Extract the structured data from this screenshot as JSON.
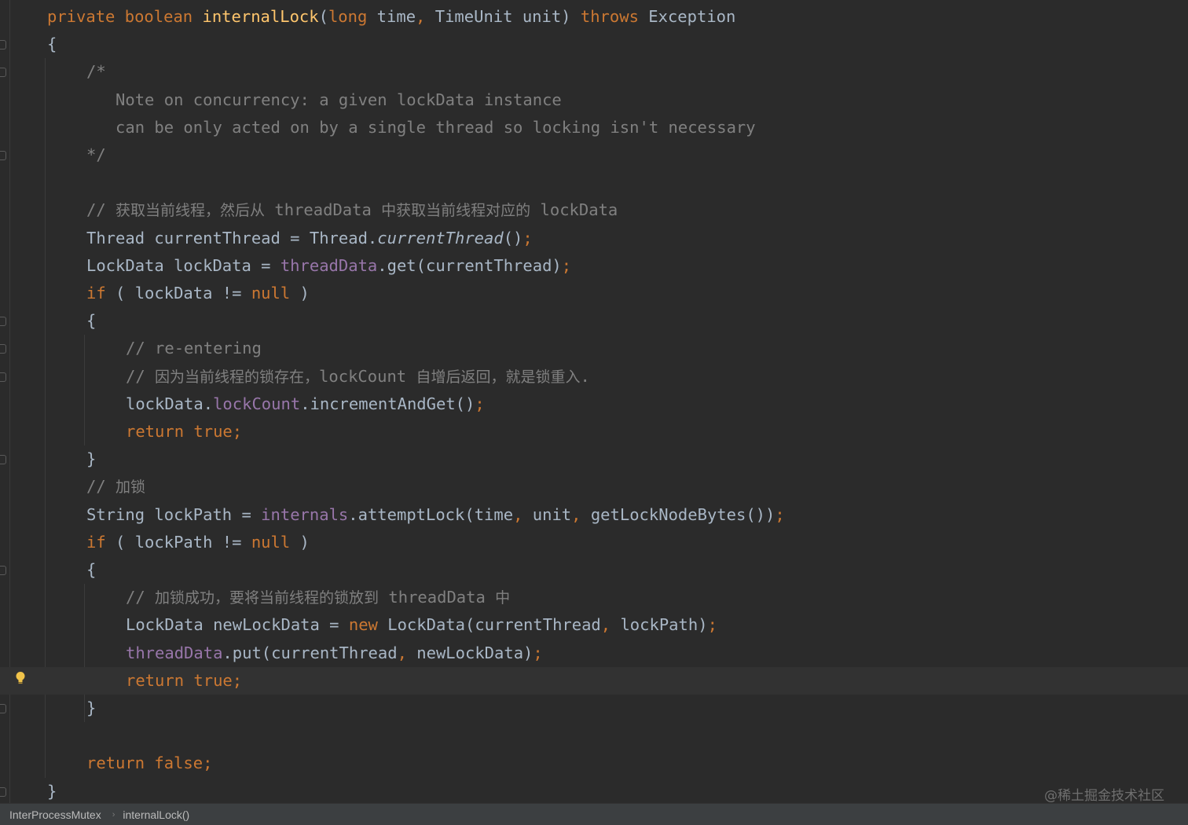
{
  "colors": {
    "background": "#2b2b2b",
    "keyword": "#cc7832",
    "method_declaration": "#ffc66d",
    "identifier": "#a9b7c6",
    "field": "#9876aa",
    "comment": "#808080",
    "current_line": "#323232",
    "breadcrumb_bar": "#3c3f41"
  },
  "editor": {
    "lines": [
      {
        "indent": 0,
        "tokens": [
          {
            "t": "private ",
            "c": "kw"
          },
          {
            "t": "boolean ",
            "c": "kw"
          },
          {
            "t": "internalLock",
            "c": "fn"
          },
          {
            "t": "(",
            "c": "plain"
          },
          {
            "t": "long ",
            "c": "kw"
          },
          {
            "t": "time",
            "c": "plain"
          },
          {
            "t": ", ",
            "c": "punct"
          },
          {
            "t": "TimeUnit unit) ",
            "c": "plain"
          },
          {
            "t": "throws ",
            "c": "kw"
          },
          {
            "t": "Exception",
            "c": "plain"
          }
        ]
      },
      {
        "indent": 0,
        "tokens": [
          {
            "t": "{",
            "c": "plain"
          }
        ]
      },
      {
        "indent": 1,
        "tokens": [
          {
            "t": "/*",
            "c": "comment"
          }
        ]
      },
      {
        "indent": 1,
        "tokens": [
          {
            "t": "   Note on concurrency: a given lockData instance",
            "c": "comment"
          }
        ]
      },
      {
        "indent": 1,
        "tokens": [
          {
            "t": "   can be only acted on by a single thread so locking isn't necessary",
            "c": "comment"
          }
        ]
      },
      {
        "indent": 1,
        "tokens": [
          {
            "t": "*/",
            "c": "comment"
          }
        ]
      },
      {
        "indent": 1,
        "tokens": []
      },
      {
        "indent": 1,
        "tokens": [
          {
            "t": "// ",
            "c": "comment"
          },
          {
            "t": "获取当前线程，然后从",
            "c": "comment-cjk"
          },
          {
            "t": " threadData ",
            "c": "comment"
          },
          {
            "t": "中获取当前线程对应的",
            "c": "comment-cjk"
          },
          {
            "t": " lockData",
            "c": "comment"
          }
        ]
      },
      {
        "indent": 1,
        "tokens": [
          {
            "t": "Thread currentThread = Thread.",
            "c": "plain"
          },
          {
            "t": "currentThread",
            "c": "static"
          },
          {
            "t": "()",
            "c": "plain"
          },
          {
            "t": ";",
            "c": "punct"
          }
        ]
      },
      {
        "indent": 1,
        "tokens": [
          {
            "t": "LockData lockData = ",
            "c": "plain"
          },
          {
            "t": "threadData",
            "c": "field"
          },
          {
            "t": ".get(currentThread)",
            "c": "plain"
          },
          {
            "t": ";",
            "c": "punct"
          }
        ]
      },
      {
        "indent": 1,
        "tokens": [
          {
            "t": "if ",
            "c": "kw"
          },
          {
            "t": "( lockData != ",
            "c": "plain"
          },
          {
            "t": "null ",
            "c": "kw"
          },
          {
            "t": ")",
            "c": "plain"
          }
        ]
      },
      {
        "indent": 1,
        "tokens": [
          {
            "t": "{",
            "c": "plain"
          }
        ]
      },
      {
        "indent": 2,
        "tokens": [
          {
            "t": "// re-entering",
            "c": "comment"
          }
        ]
      },
      {
        "indent": 2,
        "tokens": [
          {
            "t": "// ",
            "c": "comment"
          },
          {
            "t": "因为当前线程的锁存在，",
            "c": "comment-cjk"
          },
          {
            "t": "lockCount ",
            "c": "comment"
          },
          {
            "t": "自增后返回，就是锁重入",
            "c": "comment-cjk"
          },
          {
            "t": ".",
            "c": "comment"
          }
        ]
      },
      {
        "indent": 2,
        "tokens": [
          {
            "t": "lockData.",
            "c": "plain"
          },
          {
            "t": "lockCount",
            "c": "field"
          },
          {
            "t": ".incrementAndGet()",
            "c": "plain"
          },
          {
            "t": ";",
            "c": "punct"
          }
        ]
      },
      {
        "indent": 2,
        "tokens": [
          {
            "t": "return ",
            "c": "kw"
          },
          {
            "t": "true;",
            "c": "kw"
          }
        ]
      },
      {
        "indent": 1,
        "tokens": [
          {
            "t": "}",
            "c": "plain"
          }
        ]
      },
      {
        "indent": 1,
        "tokens": [
          {
            "t": "// ",
            "c": "comment"
          },
          {
            "t": "加锁",
            "c": "comment-cjk"
          }
        ]
      },
      {
        "indent": 1,
        "tokens": [
          {
            "t": "String lockPath = ",
            "c": "plain"
          },
          {
            "t": "internals",
            "c": "field"
          },
          {
            "t": ".attemptLock(time",
            "c": "plain"
          },
          {
            "t": ", ",
            "c": "punct"
          },
          {
            "t": "unit",
            "c": "plain"
          },
          {
            "t": ", ",
            "c": "punct"
          },
          {
            "t": "getLockNodeBytes())",
            "c": "plain"
          },
          {
            "t": ";",
            "c": "punct"
          }
        ]
      },
      {
        "indent": 1,
        "tokens": [
          {
            "t": "if ",
            "c": "kw"
          },
          {
            "t": "( lockPath != ",
            "c": "plain"
          },
          {
            "t": "null ",
            "c": "kw"
          },
          {
            "t": ")",
            "c": "plain"
          }
        ]
      },
      {
        "indent": 1,
        "tokens": [
          {
            "t": "{",
            "c": "plain"
          }
        ]
      },
      {
        "indent": 2,
        "tokens": [
          {
            "t": "// ",
            "c": "comment"
          },
          {
            "t": "加锁成功，要将当前线程的锁放到",
            "c": "comment-cjk"
          },
          {
            "t": " threadData ",
            "c": "comment"
          },
          {
            "t": "中",
            "c": "comment-cjk"
          }
        ]
      },
      {
        "indent": 2,
        "tokens": [
          {
            "t": "LockData newLockData = ",
            "c": "plain"
          },
          {
            "t": "new ",
            "c": "kw"
          },
          {
            "t": "LockData(currentThread",
            "c": "plain"
          },
          {
            "t": ", ",
            "c": "punct"
          },
          {
            "t": "lockPath)",
            "c": "plain"
          },
          {
            "t": ";",
            "c": "punct"
          }
        ]
      },
      {
        "indent": 2,
        "tokens": [
          {
            "t": "threadData",
            "c": "field"
          },
          {
            "t": ".put(currentThread",
            "c": "plain"
          },
          {
            "t": ", ",
            "c": "punct"
          },
          {
            "t": "newLockData)",
            "c": "plain"
          },
          {
            "t": ";",
            "c": "punct"
          }
        ]
      },
      {
        "indent": 2,
        "current": true,
        "tokens": [
          {
            "t": "return ",
            "c": "kw"
          },
          {
            "t": "true;",
            "c": "kw"
          }
        ]
      },
      {
        "indent": 1,
        "tokens": [
          {
            "t": "}",
            "c": "plain"
          }
        ]
      },
      {
        "indent": 1,
        "tokens": []
      },
      {
        "indent": 1,
        "tokens": [
          {
            "t": "return ",
            "c": "kw"
          },
          {
            "t": "false;",
            "c": "kw"
          }
        ]
      },
      {
        "indent": 0,
        "tokens": [
          {
            "t": "}",
            "c": "plain"
          }
        ]
      }
    ]
  },
  "gutter": {
    "intention_icon": "lightbulb-icon"
  },
  "watermark": "@稀土掘金技术社区",
  "breadcrumb": {
    "items": [
      "InterProcessMutex",
      "internalLock()"
    ],
    "separator_icon": "chevron-right-icon"
  }
}
